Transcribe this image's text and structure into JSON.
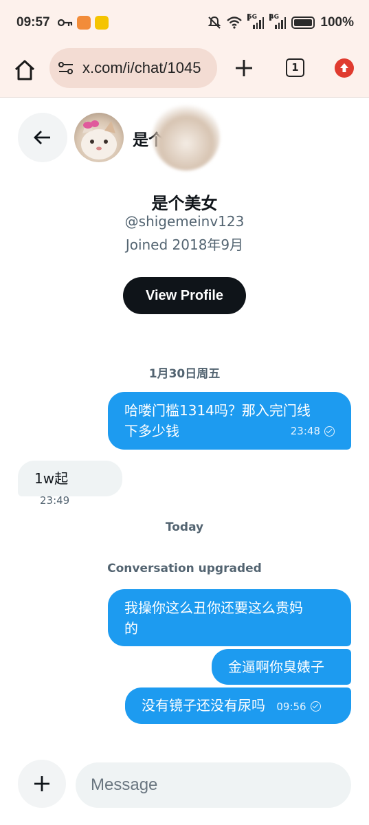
{
  "status_bar": {
    "time": "09:57",
    "net_5g": "5G",
    "net_4g": "4G",
    "battery": "100%"
  },
  "browser": {
    "url": "x.com/i/chat/1045",
    "tab_count": "1"
  },
  "chat_header": {
    "name": "是个美女"
  },
  "profile": {
    "name": "是个美女",
    "handle": "@shigemeinv123",
    "joined": "Joined 2018年9月",
    "view_profile_label": "View Profile"
  },
  "messages": {
    "date1": "1月30日周五",
    "m1_text_line1": "哈喽门槛1314吗？那入完门线",
    "m1_text_line2": "下多少钱",
    "m1_time": "23:48",
    "m2_text": "1w起",
    "m2_time": "23:49",
    "date2": "Today",
    "system_note": "Conversation upgraded",
    "m3_text_line1": "我操你这么丑你还要这么贵妈",
    "m3_text_line2": "的",
    "m4_text": "金逼啊你臭婊子",
    "m5_text": "没有镜子还没有尿吗",
    "m5_time": "09:56"
  },
  "composer": {
    "placeholder": "Message"
  },
  "colors": {
    "accent": "#1d9bf0",
    "dark_button": "#0f1419",
    "incoming_bubble": "#eff3f4",
    "browser_chrome": "#fdf1ec"
  }
}
